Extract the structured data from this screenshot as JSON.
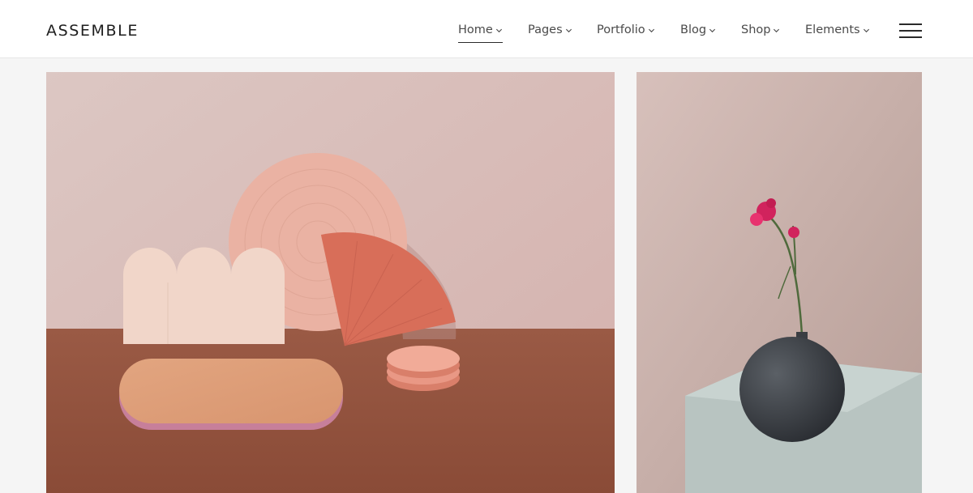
{
  "header": {
    "logo": "ASSEMBLE",
    "nav": [
      {
        "label": "Home",
        "active": true
      },
      {
        "label": "Pages",
        "active": false
      },
      {
        "label": "Portfolio",
        "active": false
      },
      {
        "label": "Blog",
        "active": false
      },
      {
        "label": "Shop",
        "active": false
      },
      {
        "label": "Elements",
        "active": false
      }
    ],
    "menu_icon": "hamburger-icon"
  },
  "gallery": {
    "items": [
      {
        "image": "pink-geometric-shapes-still-life"
      },
      {
        "image": "black-vase-with-pink-carnation"
      }
    ]
  },
  "colors": {
    "header_bg": "#ffffff",
    "page_bg": "#f5f5f5",
    "text": "#4a4a4a"
  }
}
